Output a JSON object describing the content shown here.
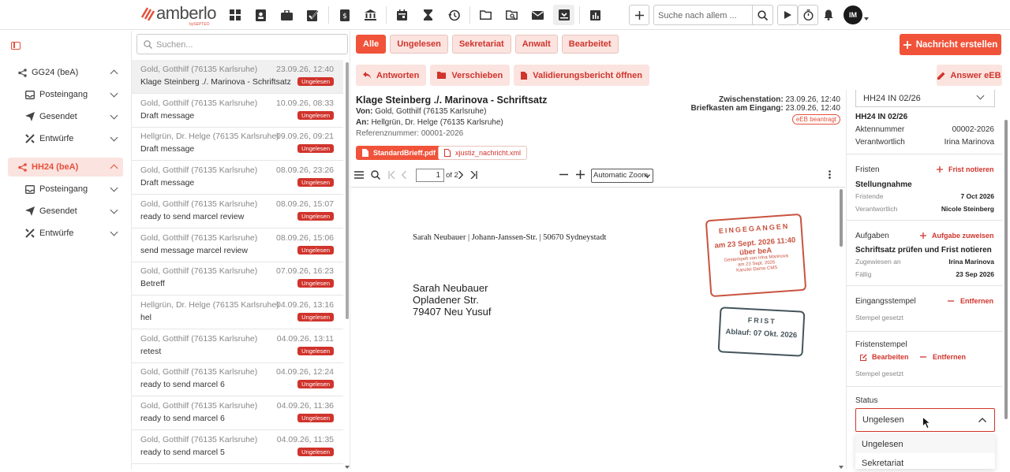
{
  "brand": {
    "name": "amberlo",
    "sub": "bySEPTEO"
  },
  "nav_icons": [
    "dashboard-icon",
    "contacts-icon",
    "briefcase-icon",
    "tasks-icon",
    "invoice-icon",
    "bank-icon",
    "calendar-icon",
    "hourglass-icon",
    "history-icon",
    "folder-icon",
    "folder-search-icon",
    "mail-icon",
    "bea-inbox-icon",
    "reports-icon"
  ],
  "top": {
    "search_placeholder": "Suche nach allem ...",
    "user_initials": "IM"
  },
  "sidebar": {
    "groups": [
      {
        "label": "GG24 (beA)",
        "items": [
          "Posteingang",
          "Gesendet",
          "Entwürfe"
        ]
      },
      {
        "label": "HH24 (beA)",
        "items": [
          "Posteingang",
          "Gesendet",
          "Entwürfe"
        ]
      }
    ]
  },
  "list": {
    "search_placeholder": "Suchen...",
    "messages": [
      {
        "from": "Gold, Gotthilf (76135 Karlsruhe)",
        "date": "23.09.26, 12:40",
        "subject": "Klage Steinberg ./. Marinova - Schriftsatz",
        "badge": "Ungelesen"
      },
      {
        "from": "Gold, Gotthilf (76135 Karlsruhe)",
        "date": "10.09.26, 08:33",
        "subject": "Draft message",
        "badge": "Ungelesen"
      },
      {
        "from": "Hellgrün, Dr. Helge (76135 Karlsruhe)",
        "date": "09.09.26, 09:21",
        "subject": "Draft message",
        "badge": "Ungelesen"
      },
      {
        "from": "Gold, Gotthilf (76135 Karlsruhe)",
        "date": "08.09.26, 23:26",
        "subject": "Draft message",
        "badge": "Ungelesen"
      },
      {
        "from": "Gold, Gotthilf (76135 Karlsruhe)",
        "date": "08.09.26, 15:07",
        "subject": "ready to send marcel review",
        "badge": "Ungelesen"
      },
      {
        "from": "Gold, Gotthilf (76135 Karlsruhe)",
        "date": "08.09.26, 15:06",
        "subject": "send message marcel review",
        "badge": "Ungelesen"
      },
      {
        "from": "Gold, Gotthilf (76135 Karlsruhe)",
        "date": "07.09.26, 16:23",
        "subject": "Betreff",
        "badge": "Ungelesen"
      },
      {
        "from": "Hellgrün, Dr. Helge (76135 Karlsruhe)",
        "date": "04.09.26, 13:16",
        "subject": "hel",
        "badge": "Ungelesen"
      },
      {
        "from": "Gold, Gotthilf (76135 Karlsruhe)",
        "date": "04.09.26, 13:11",
        "subject": "retest",
        "badge": "Ungelesen"
      },
      {
        "from": "Gold, Gotthilf (76135 Karlsruhe)",
        "date": "04.09.26, 12:24",
        "subject": "ready to send marcel 6",
        "badge": "Ungelesen"
      },
      {
        "from": "Gold, Gotthilf (76135 Karlsruhe)",
        "date": "04.09.26, 11:36",
        "subject": "ready to send marcel 6",
        "badge": "Ungelesen"
      },
      {
        "from": "Gold, Gotthilf (76135 Karlsruhe)",
        "date": "04.09.26, 11:35",
        "subject": "ready to send marcel 5",
        "badge": "Ungelesen"
      }
    ]
  },
  "filters": [
    "Alle",
    "Ungelesen",
    "Sekretariat",
    "Anwalt",
    "Bearbeitet"
  ],
  "new_message": "Nachricht erstellen",
  "actions": {
    "reply": "Antworten",
    "move": "Verschieben",
    "validation": "Validierungsbericht öffnen",
    "answer_eeb": "Answer eEB"
  },
  "detail": {
    "title": "Klage Steinberg ./. Marinova - Schriftsatz",
    "from_label": "Von:",
    "from": "Gold, Gotthilf (76135 Karlsruhe)",
    "to_label": "An:",
    "to": "Hellgrün, Dr. Helge (76135 Karlsruhe)",
    "ref_label": "Referenznummer:",
    "ref": "00001-2026",
    "zwischen_label": "Zwischenstation:",
    "zwischen": "23.09.26, 12:40",
    "eingang_label": "Briefkasten am Eingang:",
    "eingang": "23.09.26, 12:40",
    "eeb_tag": "eEB beantragt",
    "attachments": [
      "StandardBrieff.pdf",
      "xjustiz_nachricht.xml"
    ]
  },
  "pdf": {
    "page": "1",
    "of_pages": "of 2",
    "zoom": "Automatic Zoom",
    "sender_line": "Sarah Neubauer | Johann-Janssen-Str. | 50670 Sydneystadt",
    "address": [
      "Sarah Neubauer",
      "Opladener Str.",
      "79407 Neu Yusuf"
    ],
    "stamp_received": {
      "title": "EINGEGANGEN",
      "date": "am 23 Sept. 2026 11:40",
      "via": "über beA",
      "note1": "Gestempelt von Irina Marinova",
      "note2": "am 23 Sept. 2026",
      "note3": "Kanzlei Demo CMS"
    },
    "stamp_deadline": {
      "title": "FRIST",
      "date": "Ablauf: 07 Okt. 2026"
    }
  },
  "right": {
    "case_select": "HH24 IN 02/26",
    "case_title": "HH24 IN 02/26",
    "aktennummer_label": "Aktennummer",
    "aktennummer": "00002-2026",
    "verantwortlich_label": "Verantwortlich",
    "verantwortlich": "Irina Marinova",
    "fristen_label": "Fristen",
    "fristen_add": "Frist notieren",
    "frist_name": "Stellungnahme",
    "fristende_label": "Fristende",
    "fristende": "7 Oct 2026",
    "frist_verantw_label": "Verantwortlich",
    "frist_verantw": "Nicole Steinberg",
    "aufgaben_label": "Aufgaben",
    "aufgaben_add": "Aufgabe zuweisen",
    "aufgabe_name": "Schriftsatz prüfen und Frist notieren",
    "zugewiesen_label": "Zugewiesen an",
    "zugewiesen": "Irina Marinova",
    "faellig_label": "Fällig",
    "faellig": "23 Sep 2026",
    "eingangsstempel_label": "Eingangsstempel",
    "eingangsstempel_remove": "Entfernen",
    "eingangsstempel_note": "Stempel gesetzt",
    "fristenstempel_label": "Fristenstempel",
    "fristenstempel_edit": "Bearbeiten",
    "fristenstempel_remove": "Entfernen",
    "fristenstempel_note": "Stempel gesetzt",
    "status_label": "Status",
    "status_value": "Ungelesen",
    "status_options": [
      "Ungelesen",
      "Sekretariat"
    ]
  },
  "colors": {
    "accent": "#f0533a",
    "badge": "#d0342c",
    "soft": "#fbe3df"
  }
}
